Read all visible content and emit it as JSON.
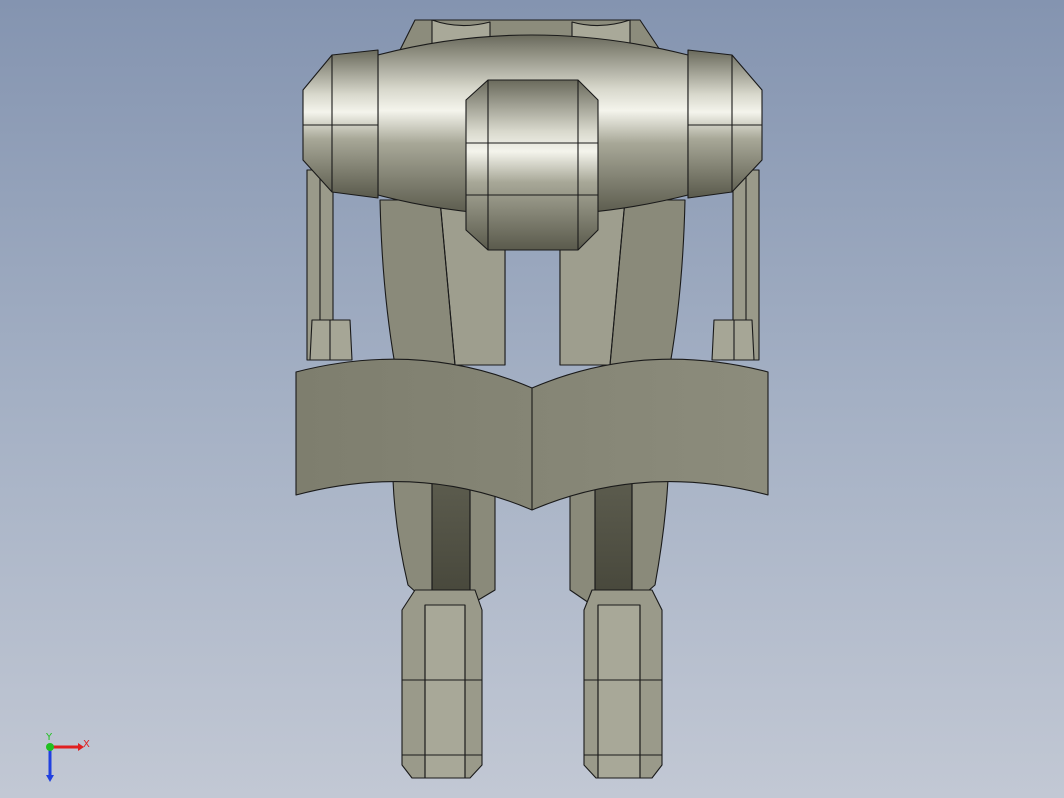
{
  "viewport": {
    "background_top": "#8494b0",
    "background_bottom": "#c2c8d4"
  },
  "model": {
    "part_color": "#8a8a7a",
    "edge_color": "#1a1a1a",
    "description_icon": "robot-cad-model"
  },
  "triad": {
    "x_label": "X",
    "y_label": "Y",
    "x_color": "#e02020",
    "y_color": "#20c020",
    "z_color": "#2040e0"
  }
}
